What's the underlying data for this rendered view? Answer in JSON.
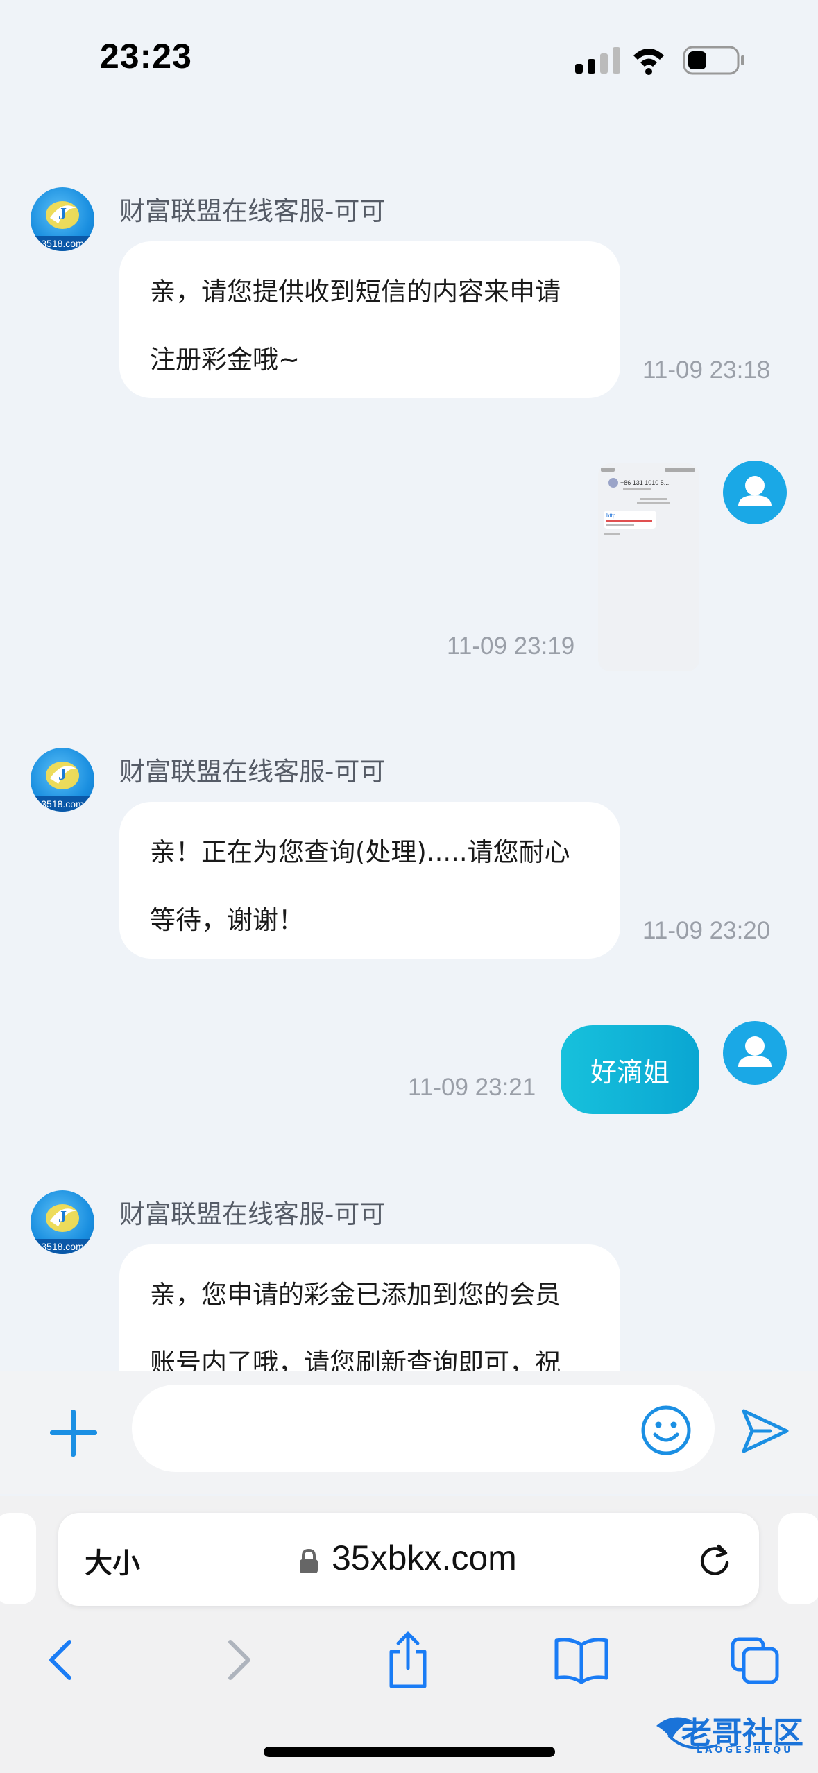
{
  "status_bar": {
    "time": "23:23"
  },
  "chat": {
    "messages": [
      {
        "from": "agent",
        "sender": "财富联盟在线客服-可可",
        "lines": [
          "亲，请您提供收到短信的内容来申请",
          "注册彩金哦~"
        ],
        "time": "11-09 23:18"
      },
      {
        "from": "user",
        "type": "image",
        "time": "11-09 23:19",
        "thumb_header": "+86 131 1010 5...",
        "thumb_link": "http"
      },
      {
        "from": "agent",
        "sender": "财富联盟在线客服-可可",
        "lines": [
          "亲！正在为您查询(处理).....请您耐心",
          "等待，谢谢！"
        ],
        "time": "11-09 23:20"
      },
      {
        "from": "user",
        "type": "text",
        "text": "好滴姐",
        "time": "11-09 23:21"
      },
      {
        "from": "agent",
        "sender": "财富联盟在线客服-可可",
        "lines": [
          "亲，您申请的彩金已添加到您的会员",
          "账号内了哦，请您刷新查询即可，祝"
        ]
      }
    ],
    "bot_avatar_text": "3518.com"
  },
  "composer": {
    "placeholder": ""
  },
  "browser": {
    "text_size_label": "大小",
    "url": "35xbkx.com"
  },
  "watermark": {
    "title": "老哥社区",
    "subtitle": "LAOGESHEQU"
  },
  "colors": {
    "accent": "#1aa8e6",
    "user_bubble": "#12b4d8",
    "icon_blue": "#1b8fe3",
    "safari_blue": "#1a7cf5"
  }
}
